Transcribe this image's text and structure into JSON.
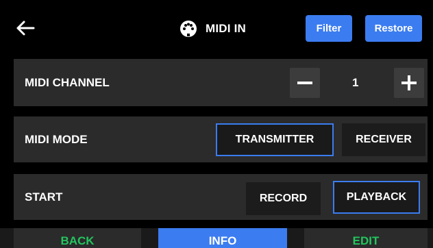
{
  "header": {
    "title": "MIDI IN",
    "title_icon": "midi-din-icon",
    "back_icon": "arrow-left-icon",
    "filter_label": "Filter",
    "restore_label": "Restore"
  },
  "rows": {
    "channel": {
      "label": "MIDI CHANNEL",
      "value": "1",
      "minus_icon": "minus-icon",
      "plus_icon": "plus-icon"
    },
    "mode": {
      "label": "MIDI MODE",
      "options": [
        "TRANSMITTER",
        "RECEIVER"
      ],
      "selected": "TRANSMITTER"
    },
    "start": {
      "label": "START",
      "options": [
        "RECORD",
        "PLAYBACK"
      ],
      "selected": "PLAYBACK"
    }
  },
  "tabs": {
    "back": "BACK",
    "info": "INFO",
    "edit": "EDIT",
    "active": "INFO"
  },
  "colors": {
    "accent": "#3b7cf0",
    "tab_text": "#22c55e",
    "row_bg": "#2b2b2b",
    "background": "#000000"
  }
}
